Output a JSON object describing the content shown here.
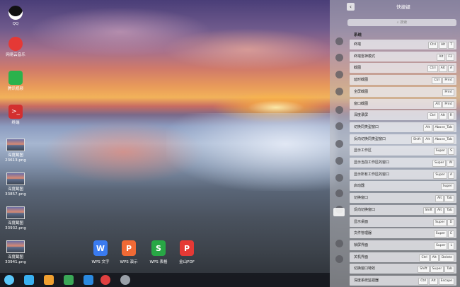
{
  "desktop": {
    "icons": [
      {
        "label": "QQ",
        "icon": "qq-icon",
        "color": "#111"
      },
      {
        "label": "网易云音乐",
        "icon": "netease-music-icon",
        "color": "#e53935"
      },
      {
        "label": "腾讯视频",
        "icon": "tencent-video-icon",
        "color": "#2bb24c"
      },
      {
        "label": "终端",
        "icon": "terminal-icon",
        "color": "#d32f2f"
      },
      {
        "label": "深度截图\n23613.png",
        "icon": "image-thumbnail"
      },
      {
        "label": "深度截图\n33857.png",
        "icon": "image-thumbnail"
      },
      {
        "label": "深度截图\n33932.png",
        "icon": "image-thumbnail"
      },
      {
        "label": "深度截图\n33941.png",
        "icon": "image-thumbnail"
      }
    ],
    "dock_files": [
      {
        "label": "WPS 文字",
        "letter": "W",
        "color": "#3a7bf0"
      },
      {
        "label": "WPS 演示",
        "letter": "P",
        "color": "#f06a35"
      },
      {
        "label": "WPS 表格",
        "letter": "S",
        "color": "#28a745"
      },
      {
        "label": "金山PDF",
        "letter": "P",
        "color": "#e53935"
      }
    ]
  },
  "taskbar": {
    "items": [
      "launcher-icon",
      "file-manager-icon",
      "app-store-icon",
      "music-icon",
      "video-icon",
      "chrome-icon",
      "settings-icon"
    ]
  },
  "panel": {
    "title": "快捷键",
    "search_placeholder": "搜索",
    "section": "系统",
    "shortcuts": [
      {
        "name": "终端",
        "keys": [
          "Ctrl",
          "Alt",
          "T"
        ]
      },
      {
        "name": "终端雷神模式",
        "keys": [
          "Alt",
          "F2"
        ]
      },
      {
        "name": "截图",
        "keys": [
          "Ctrl",
          "Alt",
          "A"
        ]
      },
      {
        "name": "延时截图",
        "keys": [
          "Ctrl",
          "Print"
        ]
      },
      {
        "name": "全屏截图",
        "keys": [
          "Print"
        ]
      },
      {
        "name": "窗口截图",
        "keys": [
          "Alt",
          "Print"
        ]
      },
      {
        "name": "深度录屏",
        "keys": [
          "Ctrl",
          "Alt",
          "R"
        ]
      },
      {
        "name": "切换同类型窗口",
        "keys": [
          "Alt",
          "Above_Tab"
        ]
      },
      {
        "name": "反向切换同类型窗口",
        "keys": [
          "Shift",
          "Alt",
          "Above_Tab"
        ]
      },
      {
        "name": "显示工作区",
        "keys": [
          "Super",
          "S"
        ]
      },
      {
        "name": "显示当前工作区的窗口",
        "keys": [
          "Super",
          "W"
        ]
      },
      {
        "name": "显示所有工作区的窗口",
        "keys": [
          "Super",
          "A"
        ]
      },
      {
        "name": "启动器",
        "keys": [
          "Super"
        ]
      },
      {
        "name": "切换窗口",
        "keys": [
          "Alt",
          "Tab"
        ]
      },
      {
        "name": "反向切换窗口",
        "keys": [
          "Shift",
          "Alt",
          "Tab"
        ]
      },
      {
        "name": "显示桌面",
        "keys": [
          "Super",
          "D"
        ]
      },
      {
        "name": "文件管理器",
        "keys": [
          "Super",
          "E"
        ]
      },
      {
        "name": "锁屏界面",
        "keys": [
          "Super",
          "L"
        ]
      },
      {
        "name": "关机界面",
        "keys": [
          "Ctrl",
          "Alt",
          "Delete"
        ]
      },
      {
        "name": "切换窗口特效",
        "keys": [
          "Shift",
          "Super",
          "Tab"
        ]
      },
      {
        "name": "深度系统监视器",
        "keys": [
          "Ctrl",
          "Alt",
          "Escape"
        ]
      }
    ],
    "side_icons": [
      "account-icon",
      "cloud-icon",
      "display-icon",
      "default-apps-icon",
      "personalization-icon",
      "network-icon",
      "sound-icon",
      "datetime-icon",
      "power-icon",
      "mouse-icon",
      "update-icon",
      "keyboard-icon",
      "info-icon",
      "general-icon"
    ]
  }
}
